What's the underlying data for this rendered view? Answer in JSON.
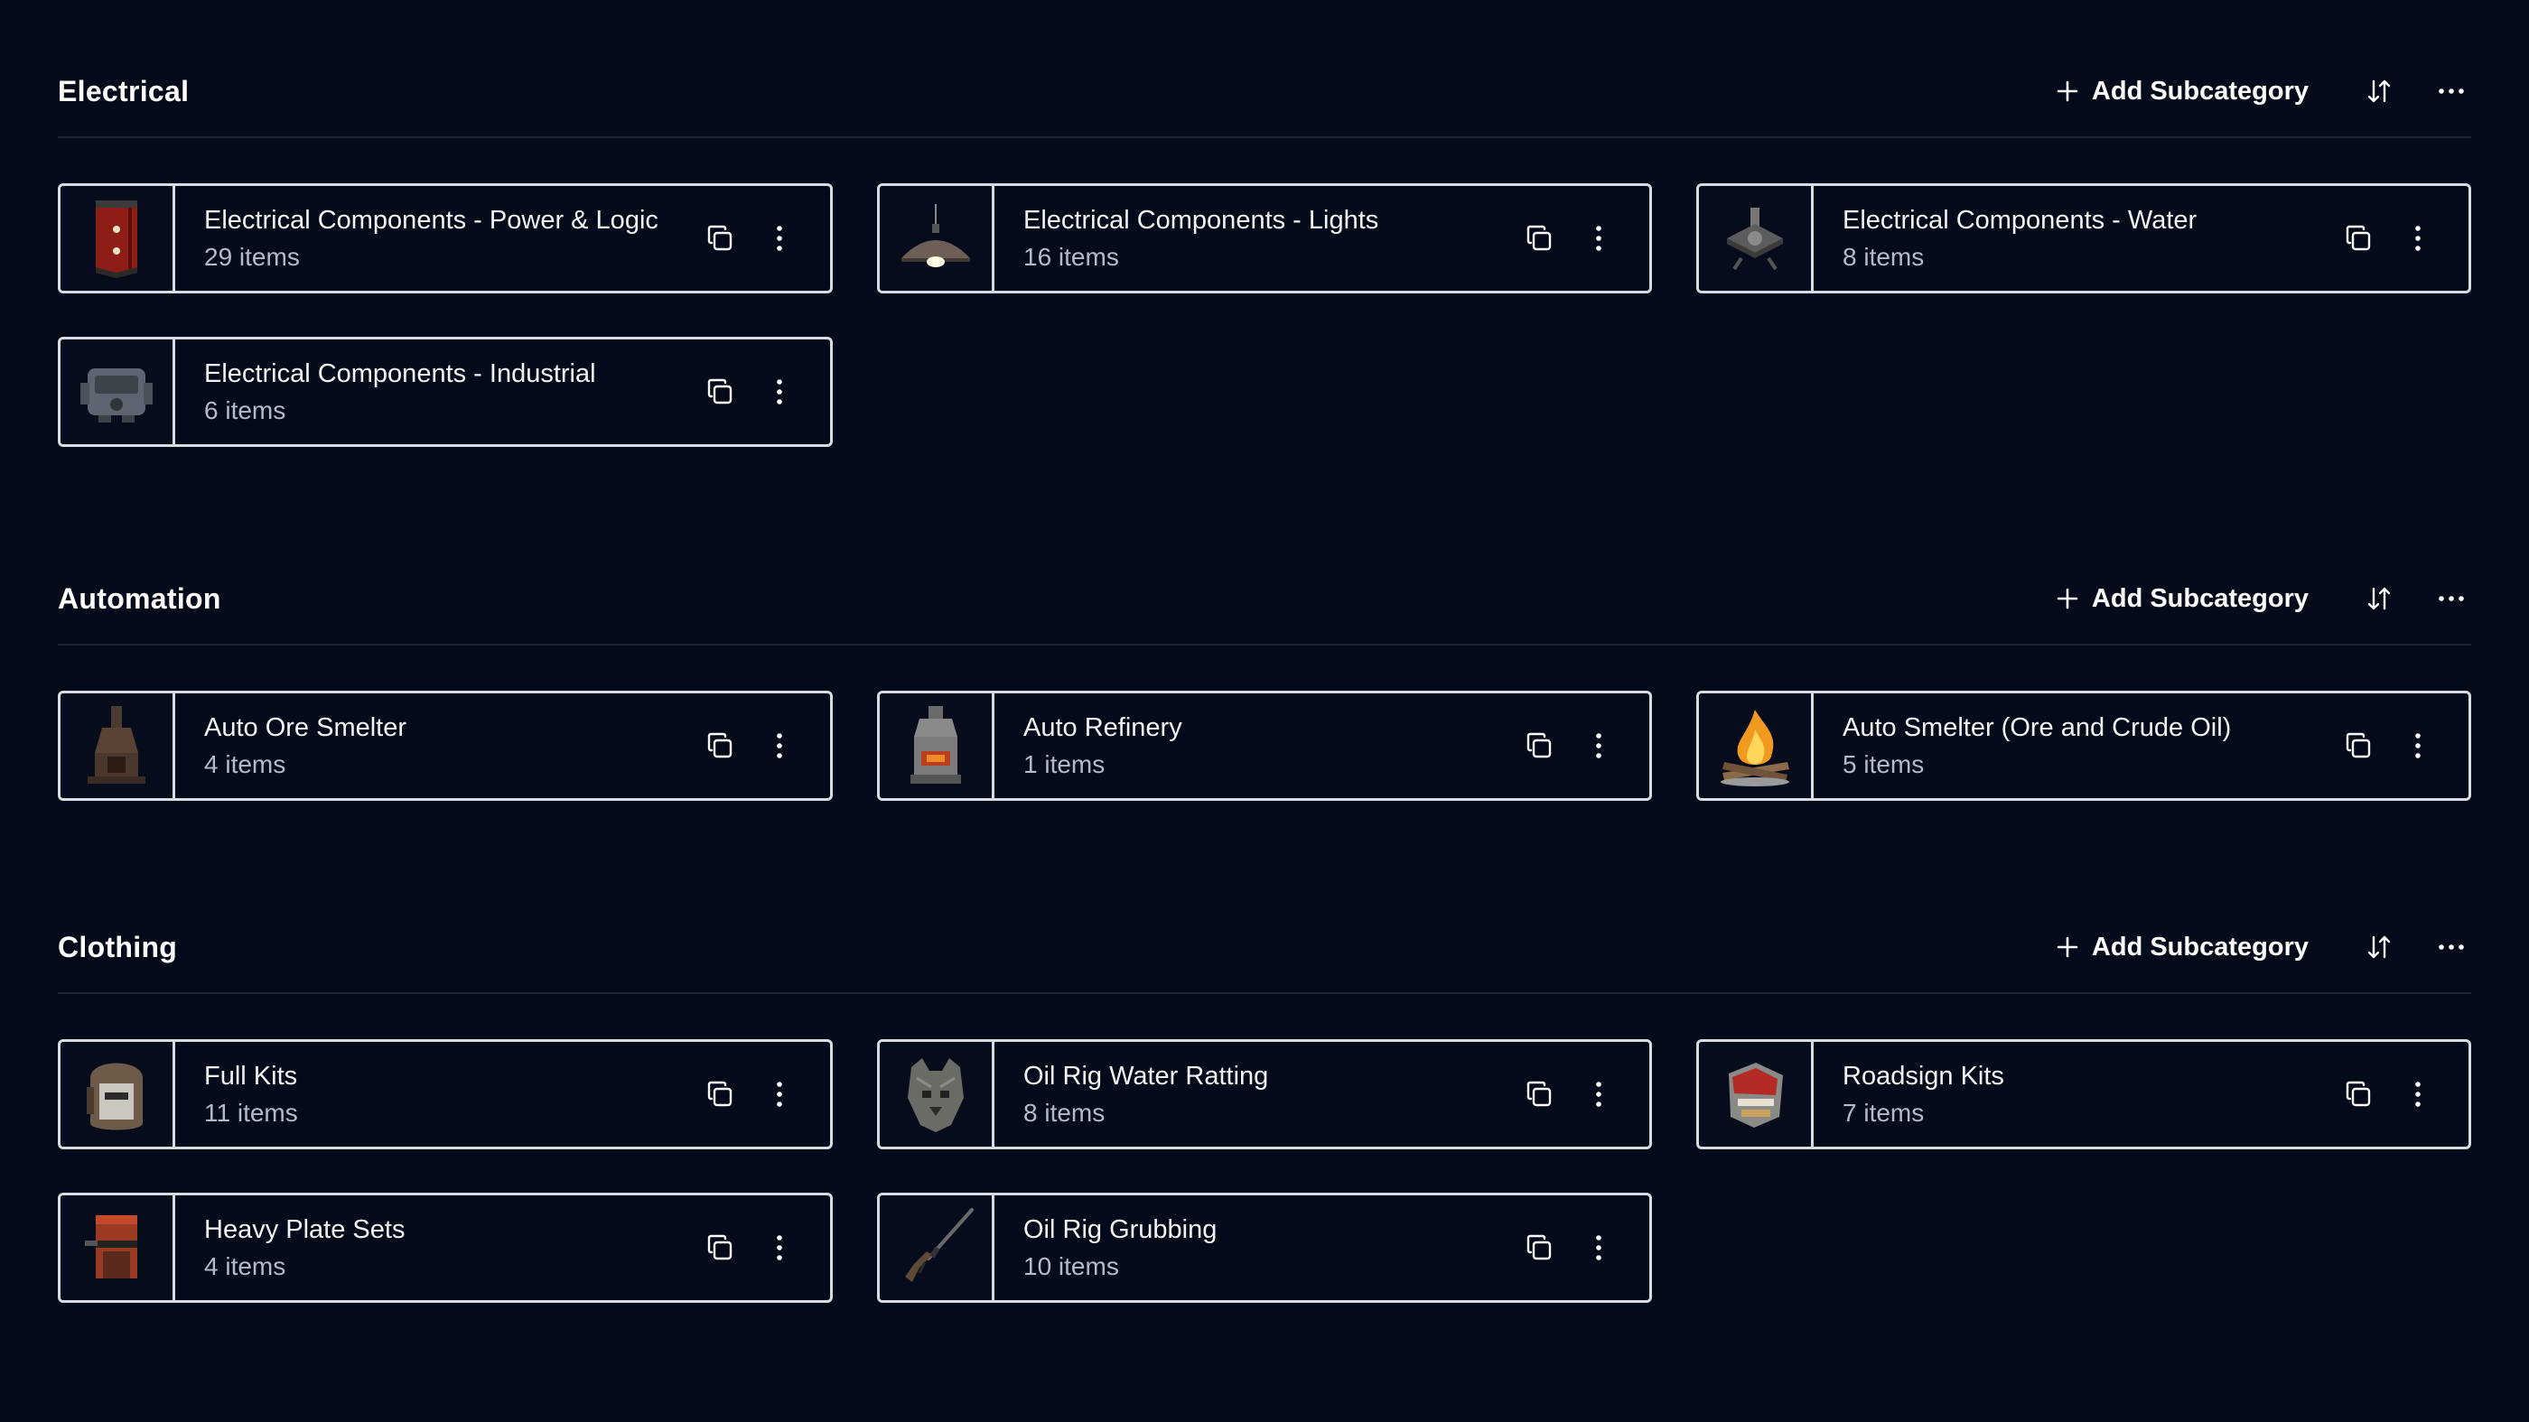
{
  "sections": [
    {
      "title": "Electrical",
      "add_label": "Add Subcategory",
      "cards": [
        {
          "title": "Electrical Components - Power & Logic",
          "count": "29 items",
          "thumb": "power-logic-icon"
        },
        {
          "title": "Electrical Components - Lights",
          "count": "16 items",
          "thumb": "ceiling-lamp-icon"
        },
        {
          "title": "Electrical Components - Water",
          "count": "8 items",
          "thumb": "water-sprinkler-icon"
        },
        {
          "title": "Electrical Components - Industrial",
          "count": "6 items",
          "thumb": "industrial-machine-icon"
        }
      ]
    },
    {
      "title": "Automation",
      "add_label": "Add Subcategory",
      "cards": [
        {
          "title": "Auto Ore Smelter",
          "count": "4 items",
          "thumb": "ore-smelter-icon"
        },
        {
          "title": "Auto Refinery",
          "count": "1 items",
          "thumb": "refinery-icon"
        },
        {
          "title": "Auto Smelter (Ore and Crude Oil)",
          "count": "5 items",
          "thumb": "campfire-icon"
        }
      ]
    },
    {
      "title": "Clothing",
      "add_label": "Add Subcategory",
      "cards": [
        {
          "title": "Full Kits",
          "count": "11 items",
          "thumb": "welding-helmet-icon"
        },
        {
          "title": "Oil Rig Water Ratting",
          "count": "8 items",
          "thumb": "wolf-headdress-icon"
        },
        {
          "title": "Roadsign Kits",
          "count": "7 items",
          "thumb": "roadsign-armor-icon"
        },
        {
          "title": "Heavy Plate Sets",
          "count": "4 items",
          "thumb": "heavy-plate-helmet-icon"
        },
        {
          "title": "Oil Rig Grubbing",
          "count": "10 items",
          "thumb": "rifle-icon"
        }
      ]
    }
  ],
  "colors": {
    "background": "#050a1a",
    "card_border": "#d9dbe2",
    "divider": "#1b2233",
    "muted_text": "#b6bac6"
  }
}
